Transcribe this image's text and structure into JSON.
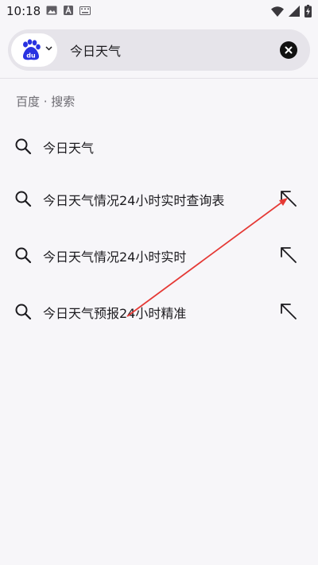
{
  "status_bar": {
    "time": "10:18",
    "left_icons": [
      "image-icon",
      "text-a-icon",
      "keyboard-icon"
    ],
    "right_icons": [
      "wifi-icon",
      "signal-icon",
      "battery-charging-icon"
    ]
  },
  "search": {
    "engine": "baidu-logo",
    "query": "今日天气"
  },
  "section": {
    "header": "百度 · 搜索"
  },
  "suggestions": [
    {
      "label": "今日天气"
    },
    {
      "label": "今日天气情况24小时实时查询表"
    },
    {
      "label": "今日天气情况24小时实时"
    },
    {
      "label": "今日天气预报24小时精准"
    }
  ],
  "colors": {
    "background": "#f7f6f9",
    "search_bar": "#e6e4ea",
    "baidu_blue": "#2932e1",
    "annotation_red": "#e53935"
  }
}
